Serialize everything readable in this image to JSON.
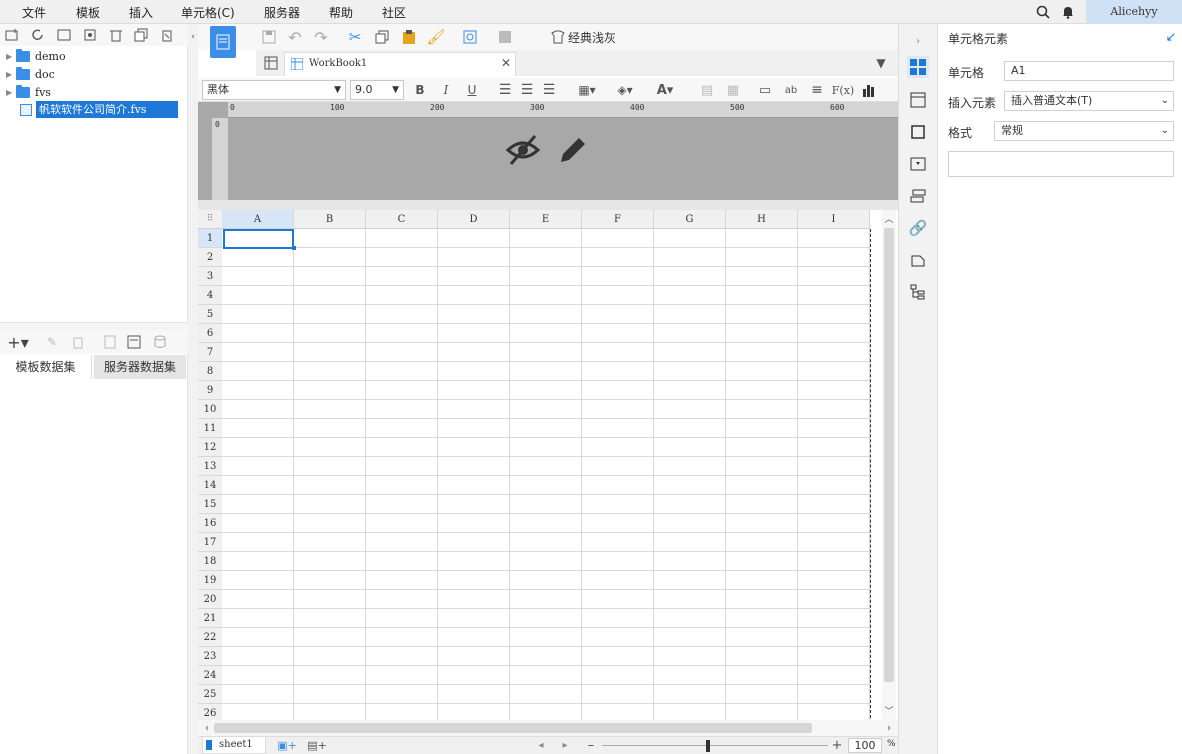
{
  "menu": [
    "文件",
    "模板",
    "插入",
    "单元格(C)",
    "服务器",
    "帮助",
    "社区"
  ],
  "user": "Alicehyy",
  "tree": [
    {
      "label": "demo",
      "type": "folder"
    },
    {
      "label": "doc",
      "type": "folder"
    },
    {
      "label": "fvs",
      "type": "folder"
    },
    {
      "label": "帆软软件公司简介.fvs",
      "type": "file",
      "selected": true
    }
  ],
  "dataset_tabs": [
    "模板数据集",
    "服务器数据集"
  ],
  "toolbar": {
    "theme_label": "经典浅灰"
  },
  "workbook_tab": "WorkBook1",
  "font": {
    "name": "黑体",
    "size": "9.0"
  },
  "ruler_ticks": [
    "0",
    "100",
    "200",
    "300",
    "400",
    "500",
    "600"
  ],
  "columns": [
    "A",
    "B",
    "C",
    "D",
    "E",
    "F",
    "G",
    "H",
    "I"
  ],
  "rows": [
    "1",
    "2",
    "3",
    "4",
    "5",
    "6",
    "7",
    "8",
    "9",
    "10",
    "11",
    "12",
    "13",
    "14",
    "15",
    "16",
    "17",
    "18",
    "19",
    "20",
    "21",
    "22",
    "23",
    "24",
    "25",
    "26"
  ],
  "sheet": "sheet1",
  "zoom": {
    "value": "100",
    "unit": "%"
  },
  "right_panel": {
    "title": "单元格元素",
    "cell_label": "单元格",
    "cell_value": "A1",
    "insert_label": "插入元素",
    "insert_value": "插入普通文本(T)",
    "format_label": "格式",
    "format_value": "常规"
  },
  "colors": {
    "accent": "#3a8ee6",
    "selection": "#1e78d7"
  }
}
